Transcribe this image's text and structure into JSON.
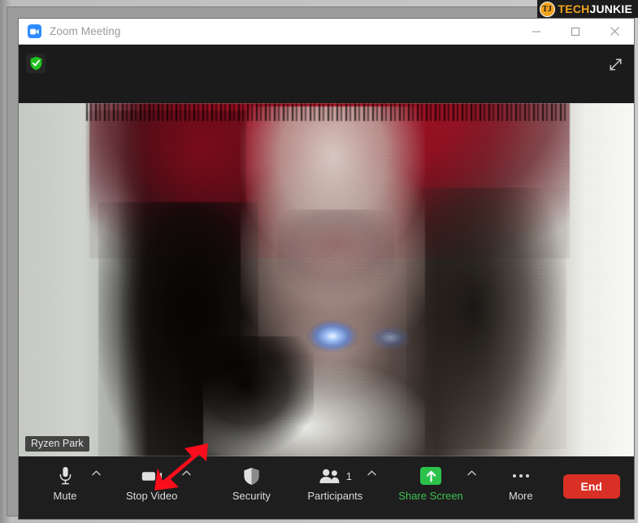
{
  "window": {
    "title": "Zoom Meeting",
    "logo_icon": "zoom-camera-icon",
    "controls": {
      "minimize": "minimize-icon",
      "maximize": "maximize-icon",
      "close": "close-icon"
    }
  },
  "meeting_header": {
    "encryption_icon": "green-shield-check-icon",
    "fullscreen_icon": "expand-diagonal-arrows-icon"
  },
  "video": {
    "participant_name": "Ryzen Park"
  },
  "toolbar": {
    "items": [
      {
        "label": "Mute",
        "icon": "microphone-icon",
        "caret": "chevron-up-icon",
        "has_caret": true
      },
      {
        "label": "Stop Video",
        "icon": "video-camera-icon",
        "caret": "chevron-up-icon",
        "has_caret": true
      },
      {
        "label": "Security",
        "icon": "shield-icon",
        "has_caret": false
      },
      {
        "label": "Participants",
        "icon": "participants-icon",
        "count": "1",
        "caret": "chevron-up-icon",
        "has_caret": true
      },
      {
        "label": "Share Screen",
        "icon": "share-screen-up-arrow-icon",
        "caret": "chevron-up-icon",
        "has_caret": true
      },
      {
        "label": "More",
        "icon": "ellipsis-icon",
        "has_caret": false
      }
    ],
    "end_label": "End"
  },
  "annotation": {
    "type": "red-arrow",
    "points_to": "Stop Video chevron",
    "color": "#fc0d1b"
  },
  "watermark": {
    "badge_text": "TJ",
    "text_primary": "TECH",
    "text_secondary": "JUNKIE",
    "color_primary": "#f0a31e",
    "color_secondary": "#ffffff"
  },
  "colors": {
    "titlebar_bg": "#ffffff",
    "toolbar_bg": "#1e1e1e",
    "end_button": "#d93025",
    "share_green": "#2bc24a",
    "shield_green": "#1fc21f",
    "zoom_blue": "#2d8cff"
  }
}
